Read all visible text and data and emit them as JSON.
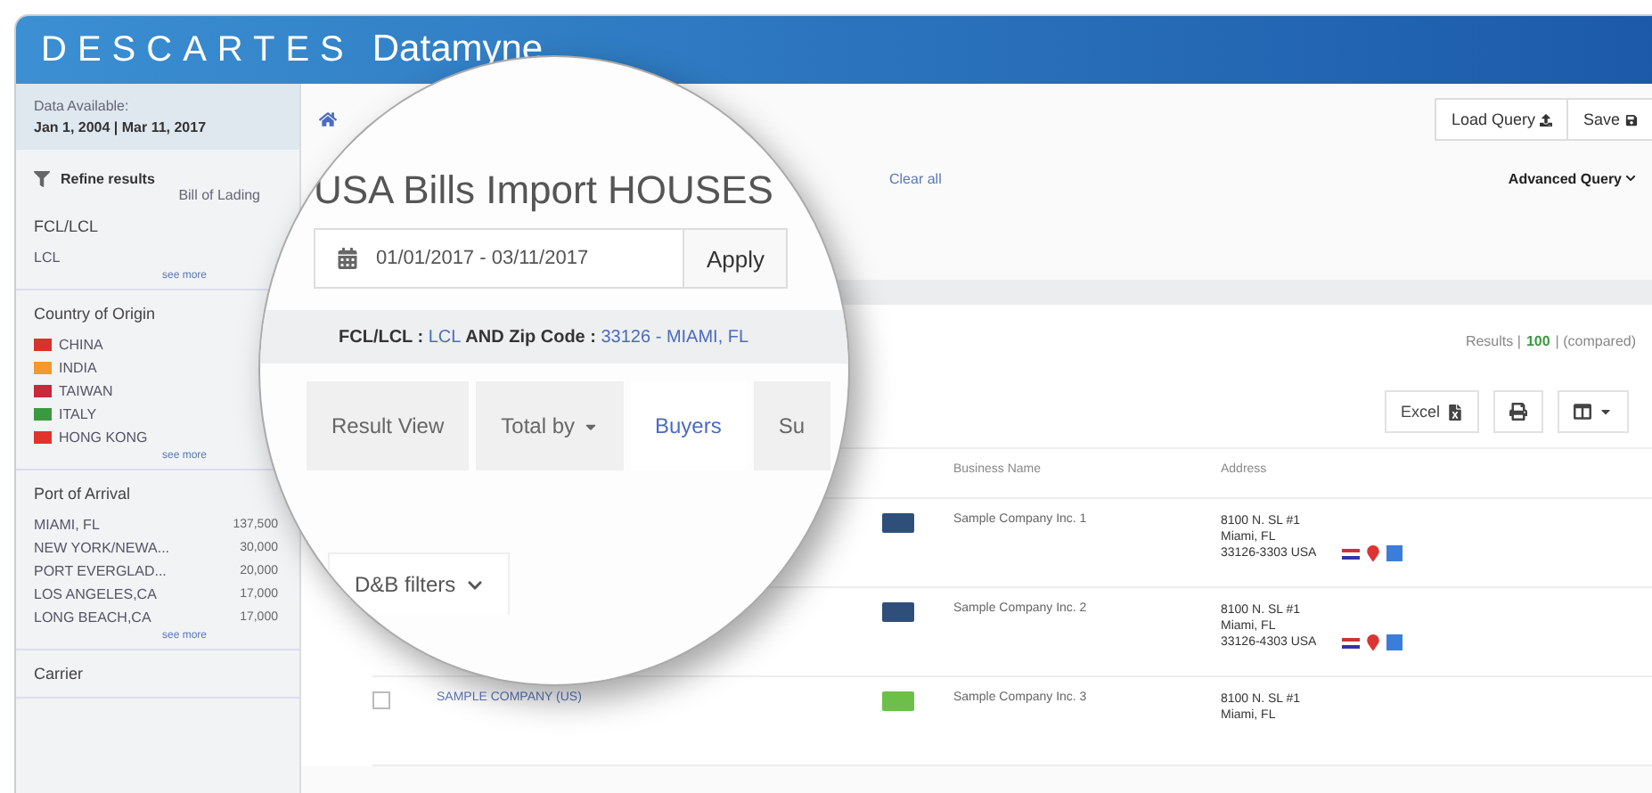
{
  "brand": {
    "logo": "DESCARTES",
    "product": "Datamyne"
  },
  "sidebar": {
    "data_label": "Data Available:",
    "data_range": "Jan 1, 2004 | Mar 11, 2017",
    "refine_title": "Refine results",
    "refine_note": "Bill of Lading",
    "sections": [
      {
        "title": "FCL/LCL",
        "items": [
          {
            "name": "LCL"
          }
        ],
        "more": "see more"
      },
      {
        "title": "Country of Origin",
        "items": [
          {
            "name": "CHINA",
            "color": "#d8322b"
          },
          {
            "name": "INDIA",
            "color": "#f29a2e"
          },
          {
            "name": "TAIWAN",
            "color": "#c8283c"
          },
          {
            "name": "ITALY",
            "color": "#3a9a3f"
          },
          {
            "name": "HONG KONG",
            "color": "#e0332d"
          }
        ],
        "more": "see more"
      },
      {
        "title": "Port of Arrival",
        "items": [
          {
            "name": "MIAMI, FL",
            "count": "137,500"
          },
          {
            "name": "NEW YORK/NEWA...",
            "count": "30,000"
          },
          {
            "name": "PORT EVERGLAD...",
            "count": "20,000"
          },
          {
            "name": "LOS ANGELES,CA",
            "count": "17,000"
          },
          {
            "name": "LONG BEACH,CA",
            "count": "17,000"
          }
        ],
        "more": "see more"
      },
      {
        "title": "Carrier"
      }
    ]
  },
  "toolbar": {
    "buttons": [
      "Load Query",
      "Save"
    ],
    "link": "Clear all",
    "advanced": "Advanced Query"
  },
  "results": {
    "label": "Results |",
    "count": "100",
    "note": "| (compared)"
  },
  "export": {
    "excel": "Excel"
  },
  "table": {
    "columns": [
      "Business Name",
      "Address"
    ],
    "rows": [
      {
        "color": "#2f4f7a",
        "business": "Sample Company Inc. 1",
        "address": [
          "8100 N. SL #1",
          "Miami, FL",
          "33126-3303 USA"
        ],
        "icons": true
      },
      {
        "color": "#2f4f7a",
        "business": "Sample Company Inc. 2",
        "address": [
          "8100 N. SL #1",
          "Miami, FL",
          "33126-4303 USA"
        ],
        "icons": true
      },
      {
        "color": "#6cc04a",
        "buyer": {
          "name": "SAMPLE COMPANY (US)",
          "checked": false
        },
        "business": "Sample Company Inc. 3",
        "address": [
          "8100 N. SL #1",
          "Miami, FL"
        ],
        "icons": false
      }
    ]
  },
  "magnifier": {
    "title": "USA Bills Import HOUSES",
    "date_range": "01/01/2017 - 03/11/2017",
    "apply": "Apply",
    "filter": [
      {
        "kind": "key",
        "text": "FCL/LCL :"
      },
      {
        "kind": "value",
        "text": "LCL"
      },
      {
        "kind": "key",
        "text": "AND Zip Code :"
      },
      {
        "kind": "value",
        "text": "33126 - MIAMI, FL"
      }
    ],
    "tabs": [
      {
        "label": "Result View",
        "selected": false,
        "caret": false
      },
      {
        "label": "Total by",
        "selected": false,
        "caret": true
      },
      {
        "label": "Buyers",
        "selected": true,
        "caret": false
      },
      {
        "label": "Su",
        "selected": false,
        "caret": false
      }
    ],
    "dnb": "D&B filters"
  }
}
